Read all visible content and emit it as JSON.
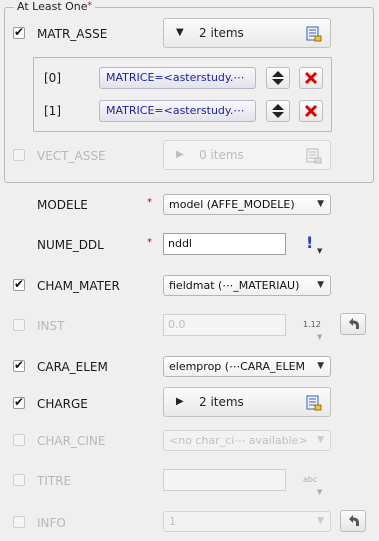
{
  "group": {
    "title": "At Least One",
    "required_mark": "*"
  },
  "matr_asse": {
    "label": "MATR_ASSE",
    "checked": true,
    "items_label": "2 items",
    "entries": [
      {
        "index": "[0]",
        "value": "MATRICE=<asterstudy.⋯"
      },
      {
        "index": "[1]",
        "value": "MATRICE=<asterstudy.⋯"
      }
    ]
  },
  "vect_asse": {
    "label": "VECT_ASSE",
    "checked": false,
    "items_label": "0 items"
  },
  "modele": {
    "label": "MODELE",
    "required_mark": "*",
    "value": "model (AFFE_MODELE)"
  },
  "nume_ddl": {
    "label": "NUME_DDL",
    "required_mark": "*",
    "value": "nddl",
    "flag": "!"
  },
  "cham_mater": {
    "label": "CHAM_MATER",
    "checked": true,
    "value": "fieldmat (⋯_MATERIAU)"
  },
  "inst": {
    "label": "INST",
    "checked": false,
    "value": "0.0",
    "type_tag": "1.12"
  },
  "cara_elem": {
    "label": "CARA_ELEM",
    "checked": true,
    "value": "elemprop (⋯CARA_ELEM"
  },
  "charge": {
    "label": "CHARGE",
    "checked": true,
    "items_label": "2 items"
  },
  "char_cine": {
    "label": "CHAR_CINE",
    "checked": false,
    "value": "<no char_ci⋯ available>"
  },
  "titre": {
    "label": "TITRE",
    "checked": false,
    "value": "",
    "type_tag": "abc"
  },
  "info": {
    "label": "INFO",
    "checked": false,
    "value": "1"
  },
  "colors": {
    "required": "#d00000",
    "matrix_text": "#1f1f9a",
    "delete": "#e00000"
  }
}
